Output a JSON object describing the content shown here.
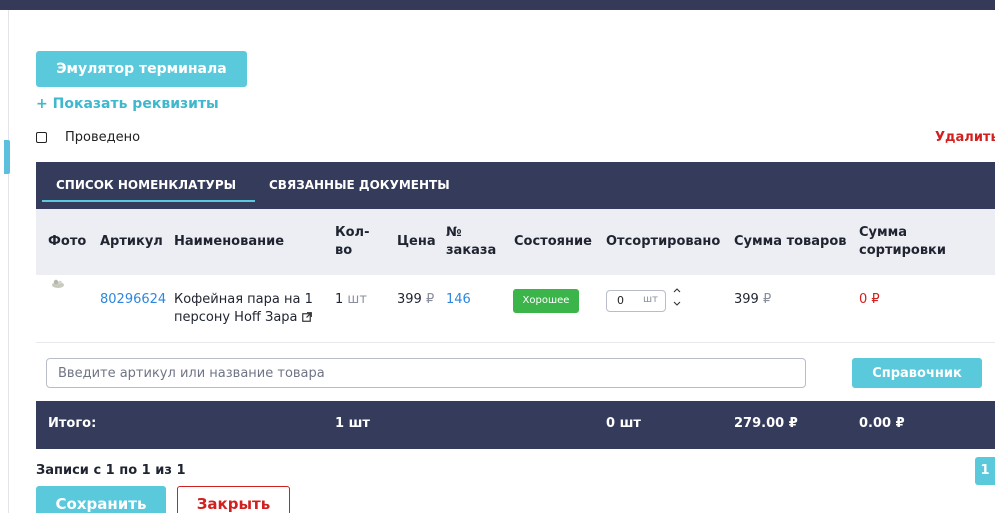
{
  "top": {
    "emulator_label": "Эмулятор терминала",
    "show_requisites": "+ Показать реквизиты",
    "done_label": "Проведено",
    "delete_label": "Удалить"
  },
  "tabs": [
    {
      "label": "СПИСОК НОМЕНКЛАТУРЫ",
      "active": true
    },
    {
      "label": "СВЯЗАННЫЕ ДОКУМЕНТЫ",
      "active": false
    }
  ],
  "table": {
    "headers": {
      "photo": "Фото",
      "article": "Артикул",
      "name": "Наименование",
      "qty_1": "Кол-",
      "qty_2": "во",
      "price": "Цена",
      "order_1": "№",
      "order_2": "заказа",
      "state": "Состояние",
      "sorted": "Отсортировано",
      "sum_goods": "Сумма товаров",
      "sum_sort_1": "Сумма",
      "sum_sort_2": "сортировки"
    },
    "rows": [
      {
        "article": "80296624",
        "name_1": "Кофейная пара на 1",
        "name_2": "персону Hoff Зара",
        "qty": "1",
        "qty_unit": "шт",
        "price": "399",
        "price_cur": "₽",
        "order": "146",
        "state": "Хорошее",
        "sorted_value": "0",
        "sorted_unit": "шт",
        "sum_goods": "399",
        "sum_goods_cur": "₽",
        "sum_sort": "0 ₽"
      }
    ]
  },
  "search": {
    "placeholder": "Введите артикул или название товара",
    "reference_button": "Справочник"
  },
  "totals": {
    "label": "Итого:",
    "qty": "1 шт",
    "sorted": "0 шт",
    "sum_goods": "279.00 ₽",
    "sum_sort": "0.00 ₽"
  },
  "footer": {
    "records": "Записи с 1 по 1 из 1",
    "page": "1",
    "save_label": "Сохранить",
    "close_label": "Закрыть"
  },
  "colors": {
    "accent": "#5bc9dc",
    "dark": "#353b5b",
    "danger": "#d21f1f",
    "link": "#2e86de",
    "success": "#3bb54a"
  }
}
